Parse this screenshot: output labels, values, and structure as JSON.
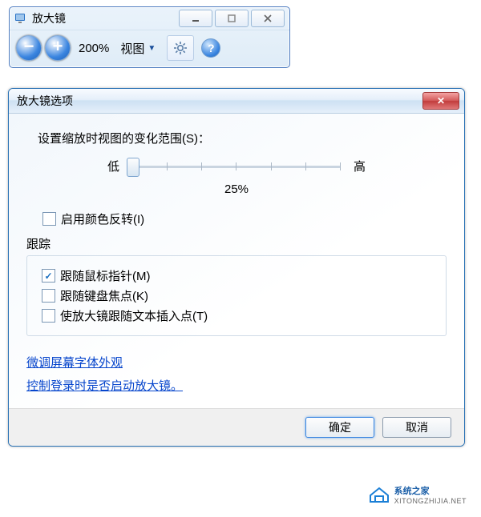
{
  "magnifier": {
    "title": "放大镜",
    "zoom": "200%",
    "view_label": "视图"
  },
  "dialog": {
    "title": "放大镜选项",
    "zoom_range_label": "设置缩放时视图的变化范围(S)：",
    "slider_low": "低",
    "slider_high": "高",
    "slider_value": "25%",
    "invert_colors": "启用颜色反转(I)",
    "tracking_label": "跟踪",
    "follow_mouse": "跟随鼠标指针(M)",
    "follow_keyboard": "跟随键盘焦点(K)",
    "follow_text": "使放大镜跟随文本插入点(T)",
    "link_font": "微调屏幕字体外观",
    "link_login": "控制登录时是否启动放大镜。",
    "ok": "确定",
    "cancel": "取消",
    "follow_mouse_checked": true,
    "follow_keyboard_checked": false,
    "follow_text_checked": false,
    "invert_colors_checked": false
  },
  "watermark": {
    "name": "系统之家",
    "url": "XITONGZHIJIA.NET"
  }
}
